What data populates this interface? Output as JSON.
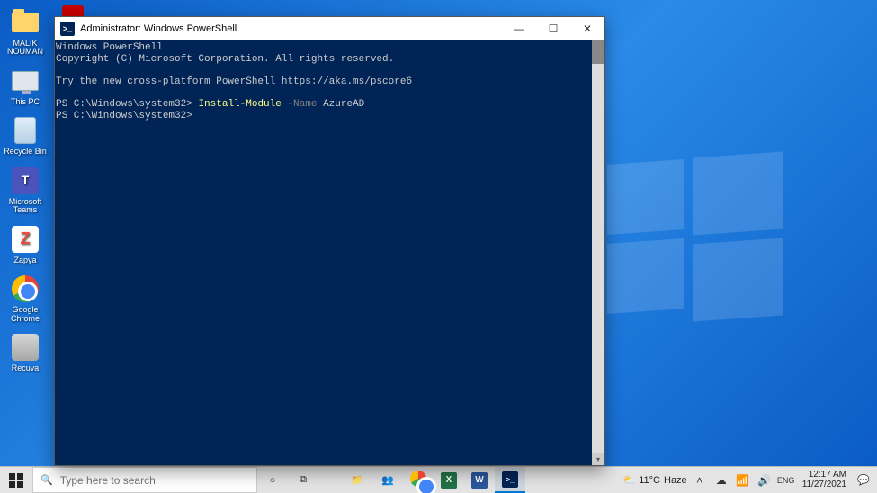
{
  "desktop_icons": [
    {
      "id": "user-folder",
      "label": "MALIK NOUMAN"
    },
    {
      "id": "this-pc",
      "label": "This PC"
    },
    {
      "id": "recycle-bin",
      "label": "Recycle Bin"
    },
    {
      "id": "teams",
      "label": "Microsoft Teams"
    },
    {
      "id": "zapya",
      "label": "Zapya"
    },
    {
      "id": "chrome",
      "label": "Google Chrome"
    },
    {
      "id": "recuva",
      "label": "Recuva"
    }
  ],
  "powershell": {
    "title": "Administrator: Windows PowerShell",
    "lines": {
      "l1": "Windows PowerShell",
      "l2": "Copyright (C) Microsoft Corporation. All rights reserved.",
      "l3a": "Try the new cross-platform PowerShell ",
      "l3b": "https://aka.ms/pscore6",
      "p1_prompt": "PS C:\\Windows\\system32> ",
      "p1_cmd": "Install-Module",
      "p1_flag": " -Name",
      "p1_arg": " AzureAD",
      "p2_prompt": "PS C:\\Windows\\system32> "
    }
  },
  "taskbar": {
    "search_placeholder": "Type here to search",
    "weather_temp": "11°C",
    "weather_cond": "Haze",
    "clock_time": "12:17 AM",
    "clock_date": "11/27/2021"
  }
}
